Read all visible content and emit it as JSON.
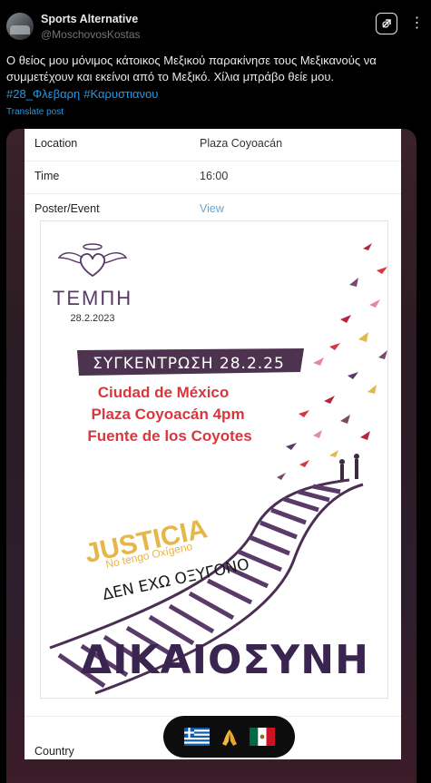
{
  "author": {
    "display_name": "Sports Alternative",
    "handle": "@MoschovosKostas"
  },
  "tweet": {
    "text": "Ο θείος μου μόνιμος κάτοικος Μεξικού παρακίνησε τους Μεξικανούς να συμμετέχουν και εκείνοι από το Μεξικό. Χίλια μπράβο θείε μου.",
    "hashtags": [
      "#28_Φλεβαρη",
      "#Καρυστιανου"
    ],
    "translate_label": "Translate post"
  },
  "form": {
    "rows": [
      {
        "label": "Location",
        "value": "Plaza Coyoacán"
      },
      {
        "label": "Time",
        "value": "16:00"
      },
      {
        "label": "Poster/Event",
        "value": "View"
      }
    ],
    "country_label": "Country"
  },
  "poster": {
    "tempi": "ΤΕΜΠΗ",
    "date": "28.2.2023",
    "banner": "ΣΥΓΚΕΝΤΡΩΣΗ 28.2.25",
    "line1": "Ciudad de México",
    "line2": "Plaza Coyoacán 4pm",
    "line3": "Fuente de los Coyotes",
    "justicia": "JUSTICIA",
    "no_tengo": "No tengo Oxígeno",
    "den_exo": "ΔΕΝ ΕΧΩ ΟΞΥΓΟΝΟ",
    "dikaiosyni": "ΔΙΚΑΙΟΣΥΝΗ",
    "colors": {
      "purple": "#5a3a68",
      "red": "#d9363e",
      "gold": "#e5b64a"
    }
  },
  "reactions": [
    "greek-flag",
    "folded-hands",
    "mexican-flag"
  ]
}
